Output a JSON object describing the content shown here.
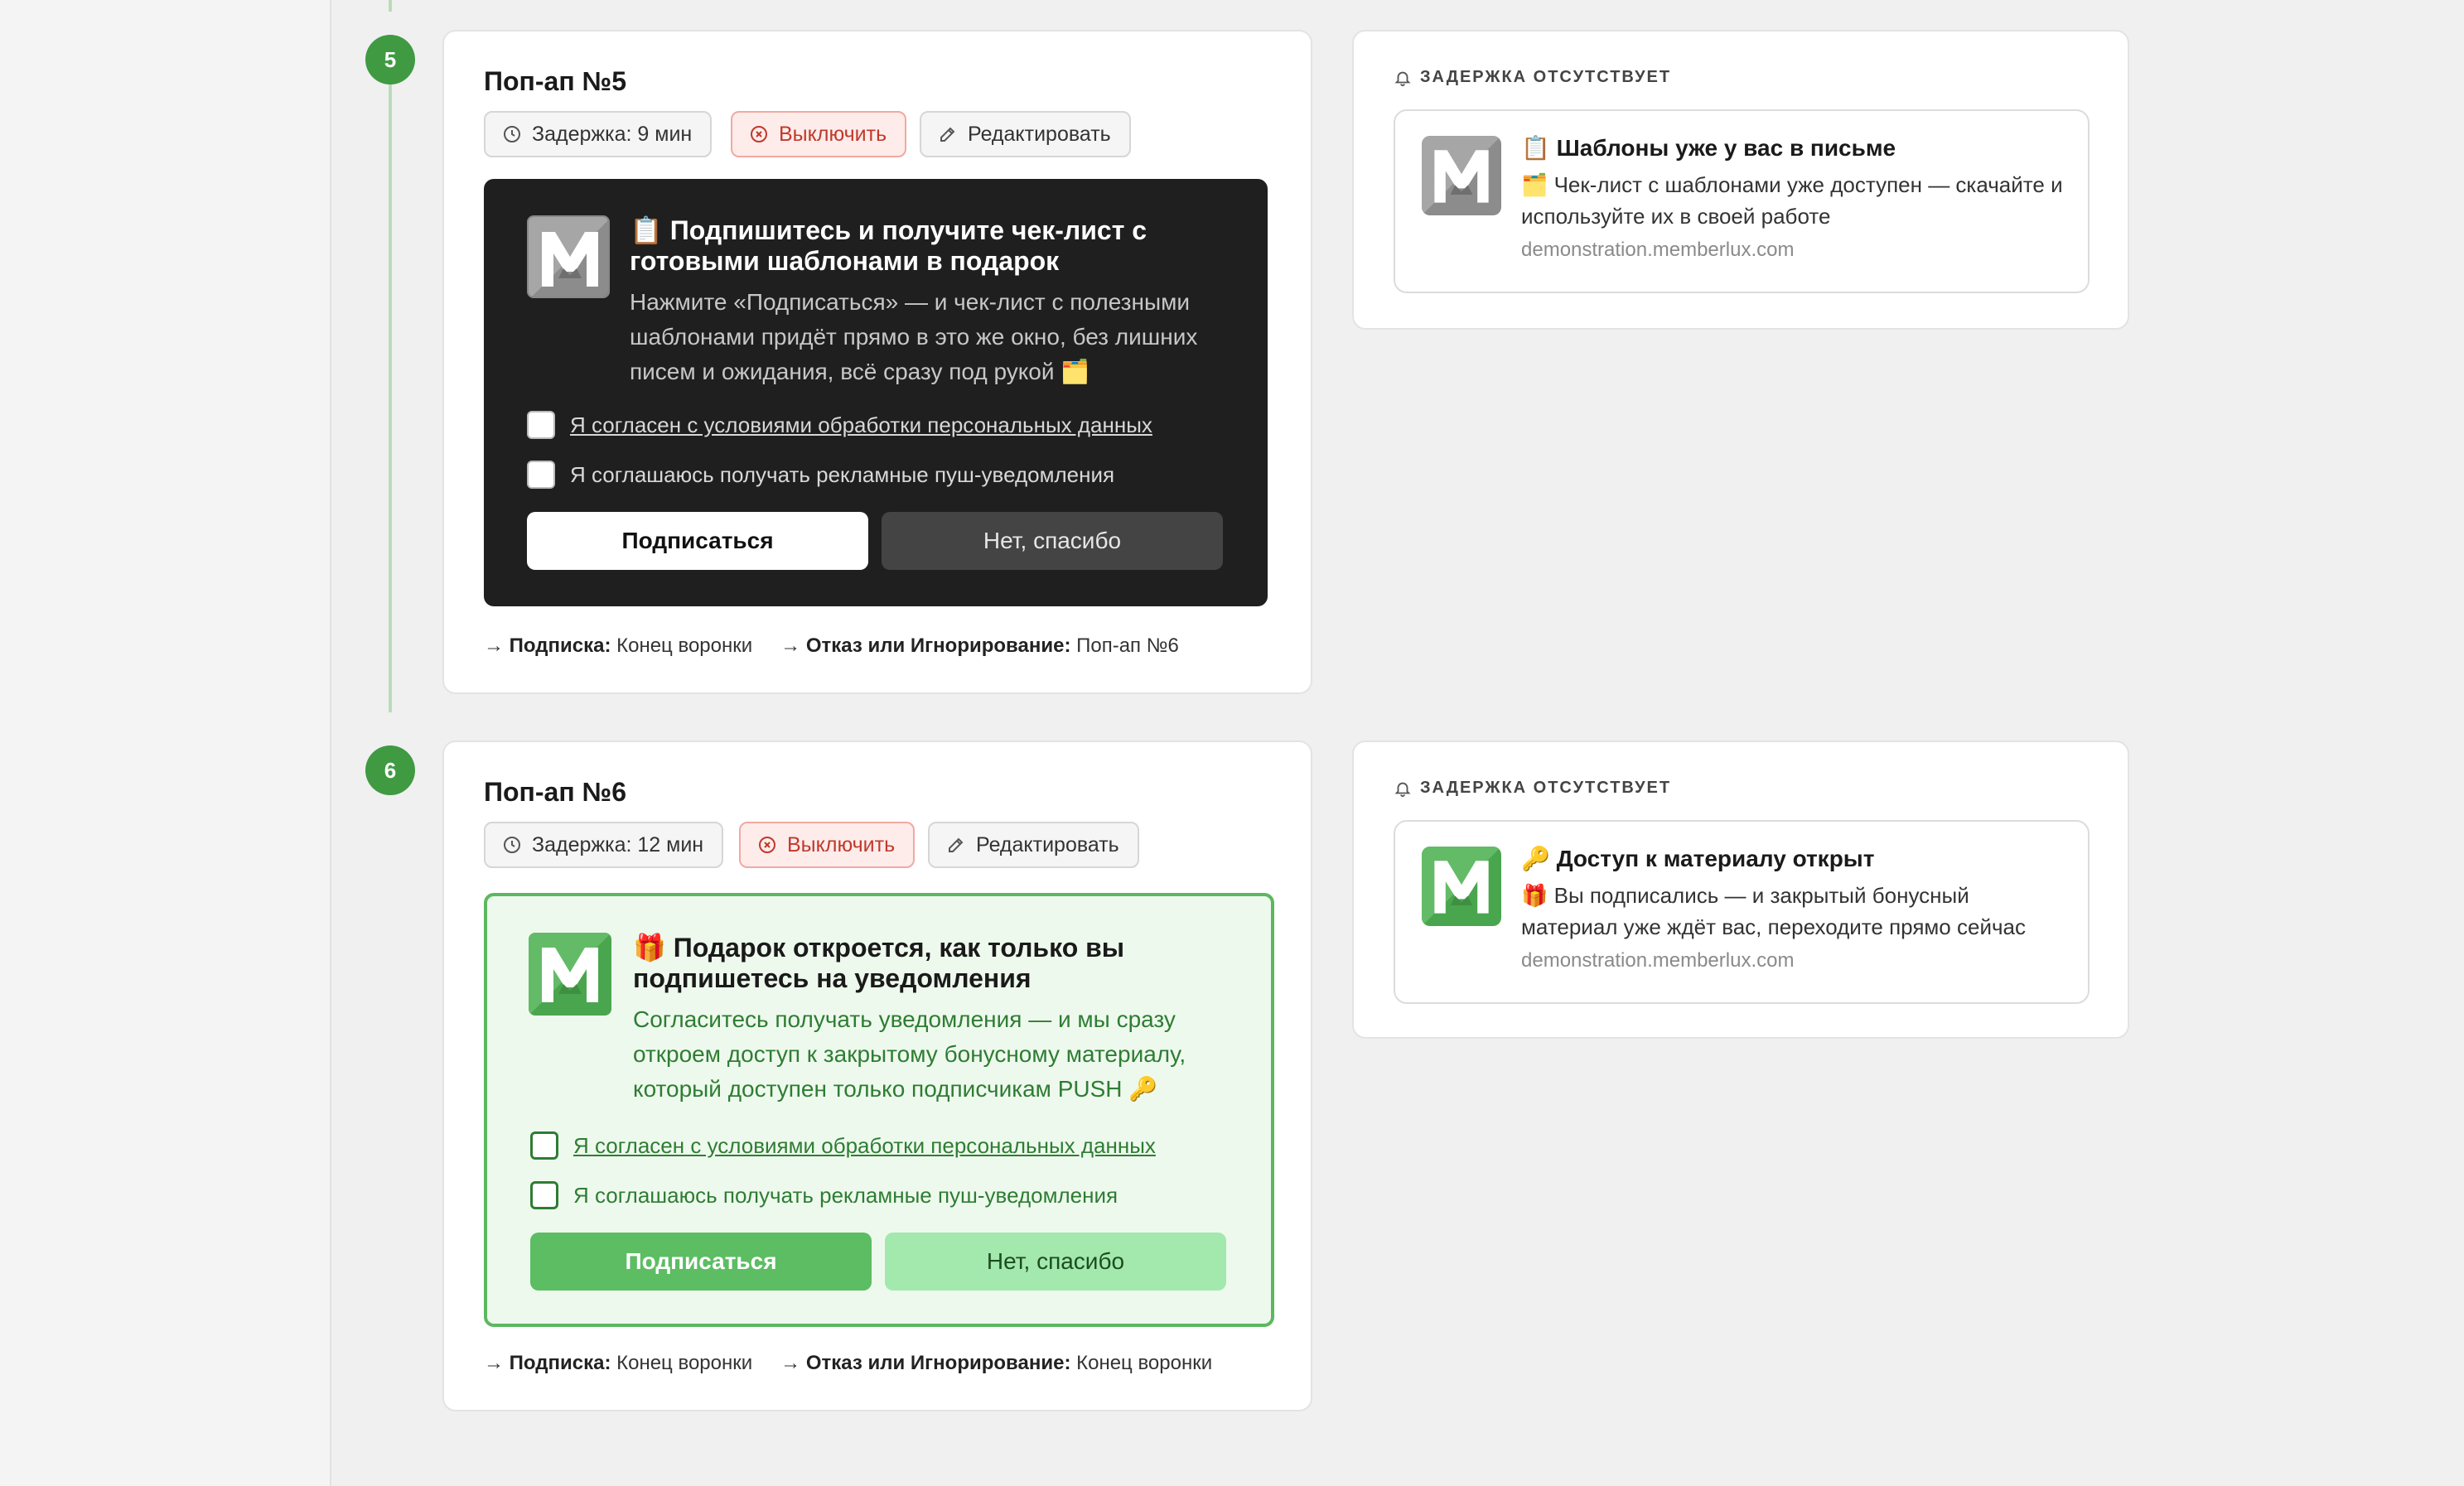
{
  "steps": [
    {
      "number": "5",
      "title": "Поп-ап №5",
      "delay_label": "Задержка: 9 мин",
      "disable_label": "Выключить",
      "edit_label": "Редактировать",
      "popup": {
        "theme": "dark",
        "title": "📋 Подпишитесь и получите чек-лист с готовыми шаблонами в подарок",
        "text": "Нажмите «Подписаться» — и чек-лист с полезными шаблонами придёт прямо в это же окно, без лишних писем и ожидания, всё сразу под рукой 🗂️",
        "consent_label": "Я согласен с условиями обработки персональных данных",
        "marketing_label": "Я соглашаюсь получать рекламные пуш-уведомления",
        "subscribe_label": "Подписаться",
        "decline_label": "Нет, спасибо"
      },
      "routes": {
        "subscribe_key": "Подписка:",
        "subscribe_value": "Конец воронки",
        "decline_key": "Отказ или Игнорирование:",
        "decline_value": "Поп-ап №6"
      },
      "notification": {
        "delay_header": "ЗАДЕРЖКА ОТСУТСТВУЕТ",
        "title": "📋 Шаблоны уже у вас в письме",
        "text": "🗂️ Чек-лист с шаблонами уже доступен — скачайте и используйте их в своей работе",
        "url": "demonstration.memberlux.com"
      }
    },
    {
      "number": "6",
      "title": "Поп-ап №6",
      "delay_label": "Задержка: 12 мин",
      "disable_label": "Выключить",
      "edit_label": "Редактировать",
      "popup": {
        "theme": "green",
        "title": "🎁 Подарок откроется, как только вы подпишетесь на уведомления",
        "text": "Согласитесь получать уведомления — и мы сразу откроем доступ к закрытому бонусному материалу, который доступен только подписчикам PUSH 🔑",
        "consent_label": "Я согласен с условиями обработки персональных данных",
        "marketing_label": "Я соглашаюсь получать рекламные пуш-уведомления",
        "subscribe_label": "Подписаться",
        "decline_label": "Нет, спасибо"
      },
      "routes": {
        "subscribe_key": "Подписка:",
        "subscribe_value": "Конец воронки",
        "decline_key": "Отказ или Игнорирование:",
        "decline_value": "Конец воронки"
      },
      "notification": {
        "delay_header": "ЗАДЕРЖКА ОТСУТСТВУЕТ",
        "title": "🔑 Доступ к материалу открыт",
        "text": "🎁 Вы подписались — и закрытый бонусный материал уже ждёт вас, переходите прямо сейчас",
        "url": "demonstration.memberlux.com"
      }
    }
  ],
  "icons": {
    "step_badge": "numbered-circle",
    "delay": "clock-icon",
    "disable": "x-circle-icon",
    "edit": "edit-icon",
    "notification_header": "bell-icon",
    "route_arrow": "arrow-right-icon",
    "logo": "memberlux-crown-m-logo"
  },
  "colors": {
    "accent_green": "#3f9a42",
    "danger": "#c0392b",
    "dark_popup": "#1f1f1f",
    "green_popup_bg": "#eef9ee",
    "green_button": "#5cbd63",
    "green_button_light": "#a3e8ad"
  }
}
